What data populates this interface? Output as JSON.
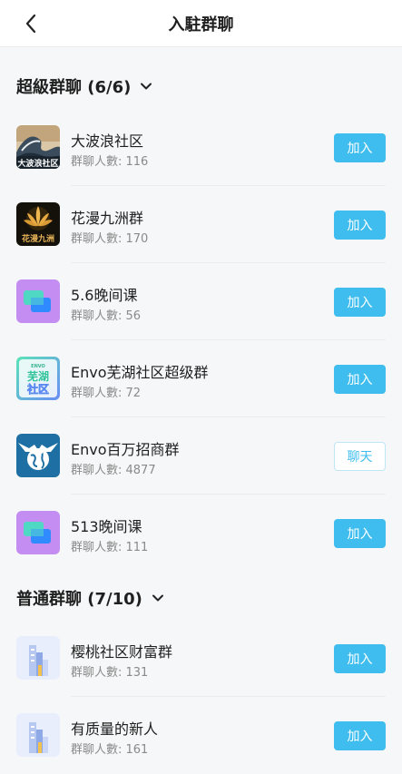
{
  "header": {
    "title": "入駐群聊"
  },
  "colors": {
    "accent": "#3ebdee"
  },
  "sections": {
    "super": {
      "title": "超級群聊 (6/6)"
    },
    "normal": {
      "title": "普通群聊 (7/10)"
    }
  },
  "groups": [
    {
      "name": "大波浪社区",
      "count": "群聊人數: 116",
      "action": "加入",
      "icon": "wave-avatar",
      "avatar_text": "大波浪社区"
    },
    {
      "name": "花漫九洲群",
      "count": "群聊人數: 170",
      "action": "加入",
      "icon": "lotus-avatar",
      "avatar_text": "花漫九洲"
    },
    {
      "name": "5.6晚间课",
      "count": "群聊人數: 56",
      "action": "加入",
      "icon": "chat-bubbles-avatar"
    },
    {
      "name": "Envo芜湖社区超级群",
      "count": "群聊人數: 72",
      "action": "加入",
      "icon": "wuhu-avatar",
      "avatar_text_top": "ENVO",
      "avatar_text_a": "芜湖",
      "avatar_text_b": "社区"
    },
    {
      "name": "Envo百万招商群",
      "count": "群聊人數: 4877",
      "action": "聊天",
      "icon": "eagle-globe-avatar"
    },
    {
      "name": "513晚间课",
      "count": "群聊人數: 111",
      "action": "加入",
      "icon": "chat-bubbles-avatar"
    },
    {
      "name": "樱桃社区财富群",
      "count": "群聊人數: 131",
      "action": "加入",
      "icon": "buildings-avatar"
    },
    {
      "name": "有质量的新人",
      "count": "群聊人數: 161",
      "action": "加入",
      "icon": "buildings-avatar"
    }
  ]
}
